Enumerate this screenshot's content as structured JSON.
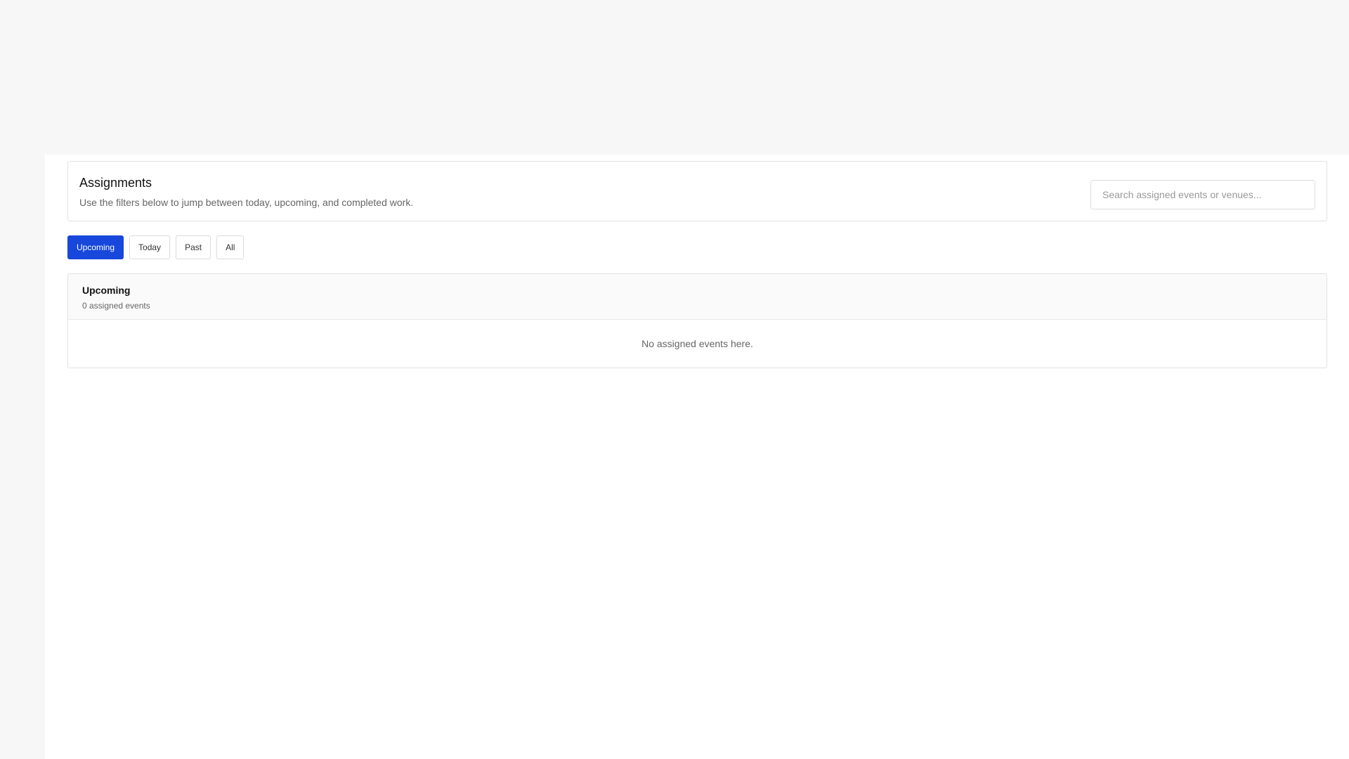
{
  "header": {
    "title": "Assignments",
    "subtitle": "Use the filters below to jump between today, upcoming, and completed work."
  },
  "search": {
    "placeholder": "Search assigned events or venues...",
    "value": ""
  },
  "filters": [
    {
      "label": "Upcoming",
      "active": true
    },
    {
      "label": "Today",
      "active": false
    },
    {
      "label": "Past",
      "active": false
    },
    {
      "label": "All",
      "active": false
    }
  ],
  "list": {
    "title": "Upcoming",
    "count_text": "0 assigned events",
    "empty_message": "No assigned events here."
  },
  "colors": {
    "accent": "#1747db",
    "background": "#f7f7f7",
    "surface": "#ffffff",
    "border": "#e2e2e2",
    "muted_text": "#666666"
  }
}
